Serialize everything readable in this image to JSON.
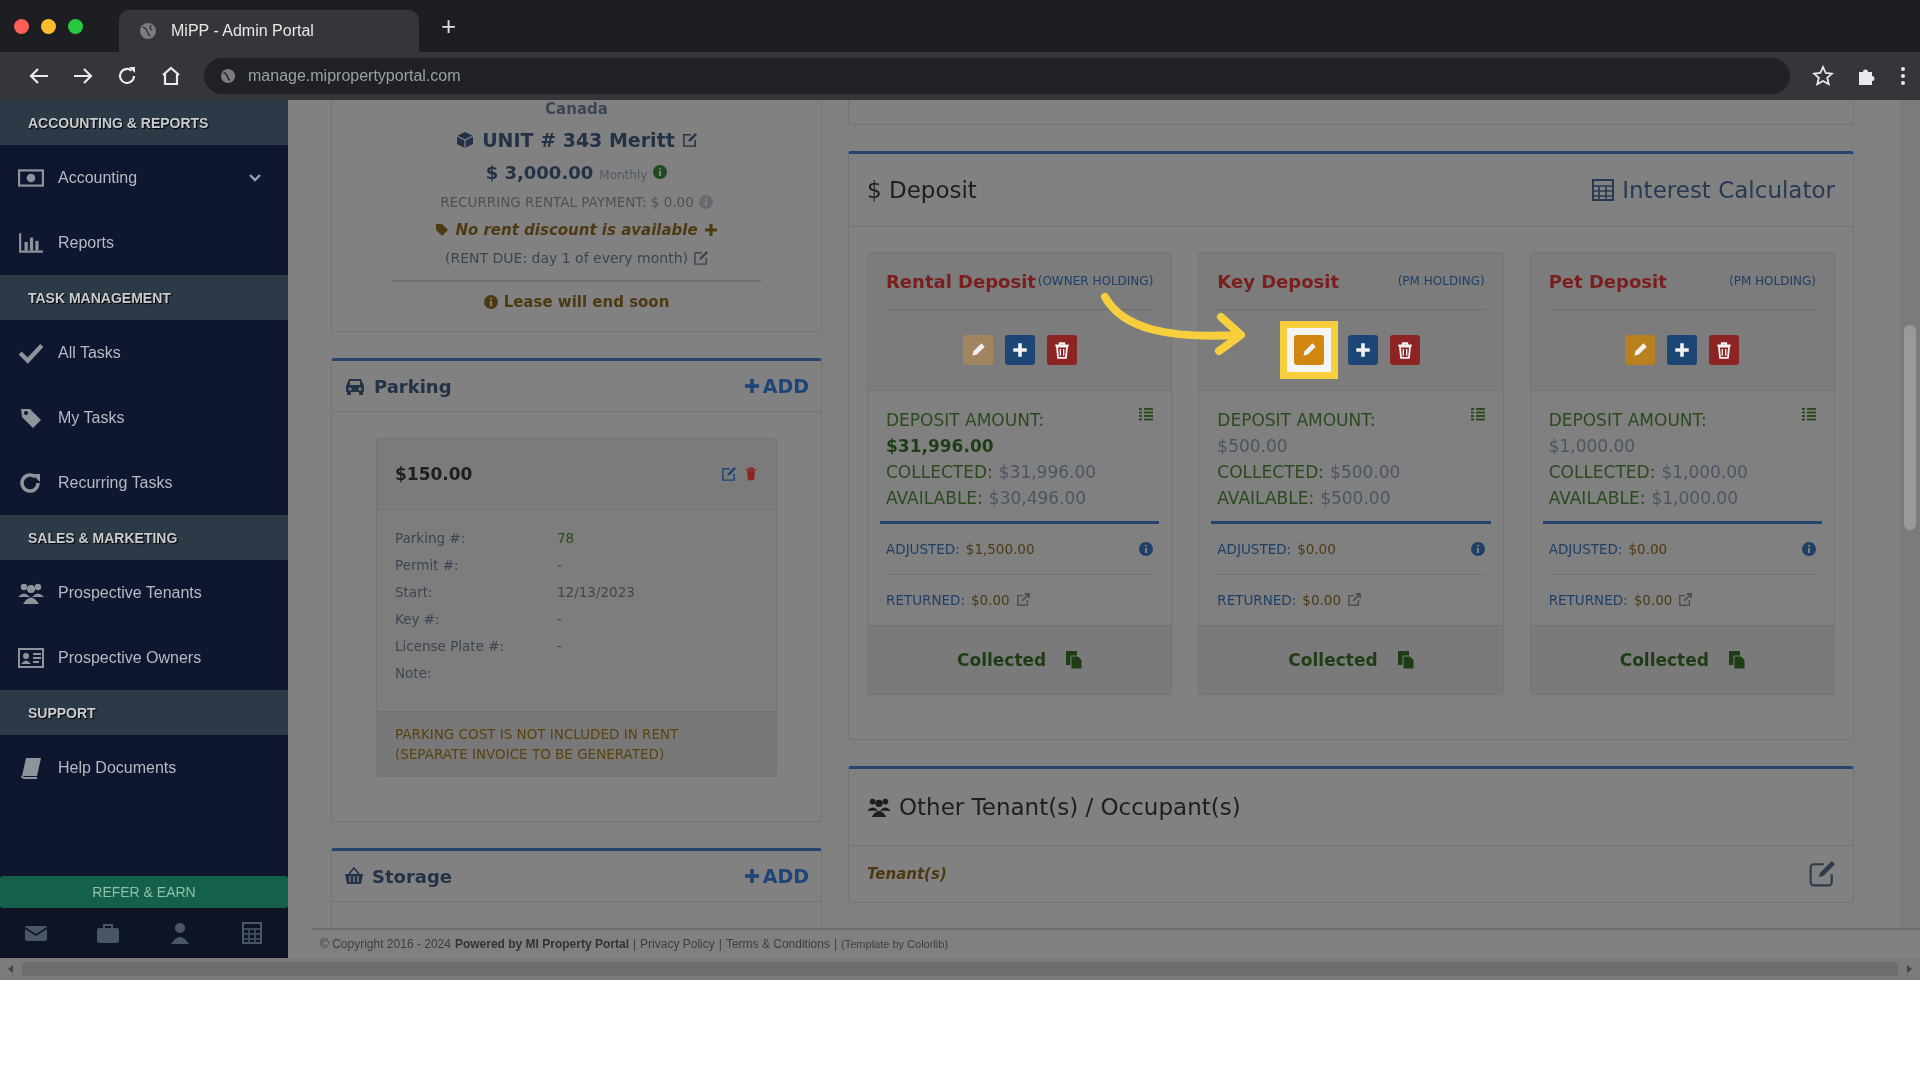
{
  "browser": {
    "tab_title": "MiPP - Admin Portal",
    "new_tab": "+",
    "url": "manage.mipropertyportal.com"
  },
  "sidebar": {
    "sections": [
      {
        "title": "ACCOUNTING & REPORTS",
        "items": [
          {
            "label": "Accounting",
            "kind": "money",
            "expandable": true
          },
          {
            "label": "Reports",
            "kind": "chart",
            "expandable": false
          }
        ]
      },
      {
        "title": "TASK MANAGEMENT",
        "items": [
          {
            "label": "All Tasks",
            "kind": "check",
            "expandable": false
          },
          {
            "label": "My Tasks",
            "kind": "tag",
            "expandable": false
          },
          {
            "label": "Recurring Tasks",
            "kind": "refresh",
            "expandable": false
          }
        ]
      },
      {
        "title": "SALES & MARKETING",
        "items": [
          {
            "label": "Prospective Tenants",
            "kind": "users",
            "expandable": false
          },
          {
            "label": "Prospective Owners",
            "kind": "idcard",
            "expandable": false
          }
        ]
      },
      {
        "title": "SUPPORT",
        "items": [
          {
            "label": "Help Documents",
            "kind": "book",
            "expandable": false
          }
        ]
      }
    ],
    "refer_button": "REFER & EARN"
  },
  "unit_card": {
    "country": "Canada",
    "unit": "UNIT # 343 Meritt",
    "rent": "$ 3,000.00",
    "period": "Monthly",
    "recurring": "RECURRING RENTAL PAYMENT: $ 0.00",
    "discount": "No rent discount is available",
    "rent_due": "(RENT DUE: day 1 of every month)",
    "lease_notice": "Lease will end soon"
  },
  "parking": {
    "title": "Parking",
    "add": "ADD",
    "amount": "$150.00",
    "fields": [
      {
        "label": "Parking #:",
        "value": "78"
      },
      {
        "label": "Permit #:",
        "value": "-"
      },
      {
        "label": "Start:",
        "value": "12/13/2023"
      },
      {
        "label": "Key #:",
        "value": "-"
      },
      {
        "label": "License Plate #:",
        "value": "-"
      },
      {
        "label": "Note:"
      }
    ],
    "notice_lines": [
      "PARKING COST IS NOT INCLUDED IN RENT",
      "(SEPARATE INVOICE TO BE GENERATED)"
    ]
  },
  "storage": {
    "title": "Storage",
    "add": "ADD"
  },
  "deposit": {
    "currency": "$",
    "title": "Deposit",
    "calculator": "Interest Calculator",
    "cards": [
      {
        "title": "Rental Deposit",
        "holding": "(OWNER HOLDING)",
        "edit_disabled": true,
        "highlighted": false,
        "amount_label": "DEPOSIT AMOUNT:",
        "amount": "$31,996.00",
        "amount_bold": true,
        "lines": [
          {
            "label": "COLLECTED:",
            "value": "$31,996.00"
          },
          {
            "label": "AVAILABLE:",
            "value": "$30,496.00"
          }
        ],
        "adjusted": {
          "label": "ADJUSTED:",
          "value": "$1,500.00"
        },
        "returned": {
          "label": "RETURNED:",
          "value": "$0.00"
        },
        "status": "Collected"
      },
      {
        "title": "Key Deposit",
        "holding": "(PM HOLDING)",
        "edit_disabled": false,
        "highlighted": true,
        "amount_label": "DEPOSIT AMOUNT:",
        "amount": "$500.00",
        "amount_bold": false,
        "lines": [
          {
            "label": "COLLECTED:",
            "value": "$500.00"
          },
          {
            "label": "AVAILABLE:",
            "value": "$500.00"
          }
        ],
        "adjusted": {
          "label": "ADJUSTED:",
          "value": "$0.00"
        },
        "returned": {
          "label": "RETURNED:",
          "value": "$0.00"
        },
        "status": "Collected"
      },
      {
        "title": "Pet Deposit",
        "holding": "(PM HOLDING)",
        "edit_disabled": false,
        "highlighted": false,
        "amount_label": "DEPOSIT AMOUNT:",
        "amount": "$1,000.00",
        "amount_bold": false,
        "lines": [
          {
            "label": "COLLECTED:",
            "value": "$1,000.00"
          },
          {
            "label": "AVAILABLE:",
            "value": "$1,000.00"
          }
        ],
        "adjusted": {
          "label": "ADJUSTED:",
          "value": "$0.00"
        },
        "returned": {
          "label": "RETURNED:",
          "value": "$0.00"
        },
        "status": "Collected"
      }
    ]
  },
  "other_tenants": {
    "title": "Other Tenant(s) / Occupant(s)",
    "subtitle": "Tenant(s)"
  },
  "footer": {
    "copyright": "© Copyright 2016 - 2024",
    "powered": "Powered by MI Property Portal",
    "separator": "|",
    "links": [
      "Privacy Policy",
      "Terms & Conditions"
    ],
    "template": "(Template by Colorlib)"
  }
}
